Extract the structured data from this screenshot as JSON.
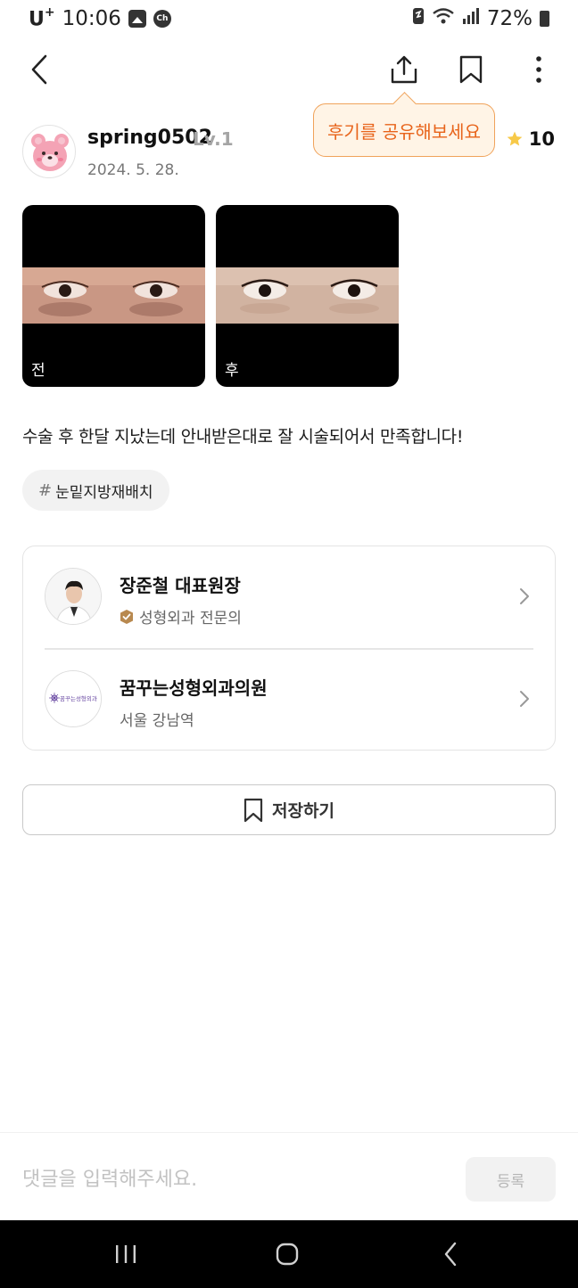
{
  "status_bar": {
    "carrier": "U",
    "carrier_sup": "+",
    "time": "10:06",
    "battery": "72%",
    "icons": [
      "gallery-icon",
      "chat-icon",
      "nfc-icon",
      "wifi-icon",
      "signal-icon",
      "battery-icon"
    ]
  },
  "nav": {
    "icons": [
      "back-arrow-icon",
      "share-icon",
      "bookmark-icon",
      "more-vertical-icon"
    ]
  },
  "tooltip": {
    "text": "후기를 공유해보세요"
  },
  "author": {
    "name": "spring0502",
    "level": "Lv.1",
    "date": "2024. 5. 28.",
    "rating": "10"
  },
  "photos": [
    {
      "label": "전"
    },
    {
      "label": "후"
    }
  ],
  "review": {
    "text": "수술 후 한달 지났는데 안내받은대로 잘 시술되어서 만족합니다!",
    "hashtag_symbol": "#",
    "hashtag": "눈밑지방재배치"
  },
  "doctor": {
    "name": "장준철 대표원장",
    "specialty": "성형외과 전문의"
  },
  "clinic": {
    "name": "꿈꾸는성형외과의원",
    "location": "서울 강남역",
    "logo_text": "꿈꾸는성형외과"
  },
  "save_button": {
    "label": "저장하기"
  },
  "comment": {
    "placeholder": "댓글을 입력해주세요.",
    "submit_label": "등록"
  },
  "colors": {
    "accent_orange": "#e8641b",
    "tooltip_bg": "#fff4e6",
    "star": "#f7c948",
    "badge": "#b8894f"
  }
}
